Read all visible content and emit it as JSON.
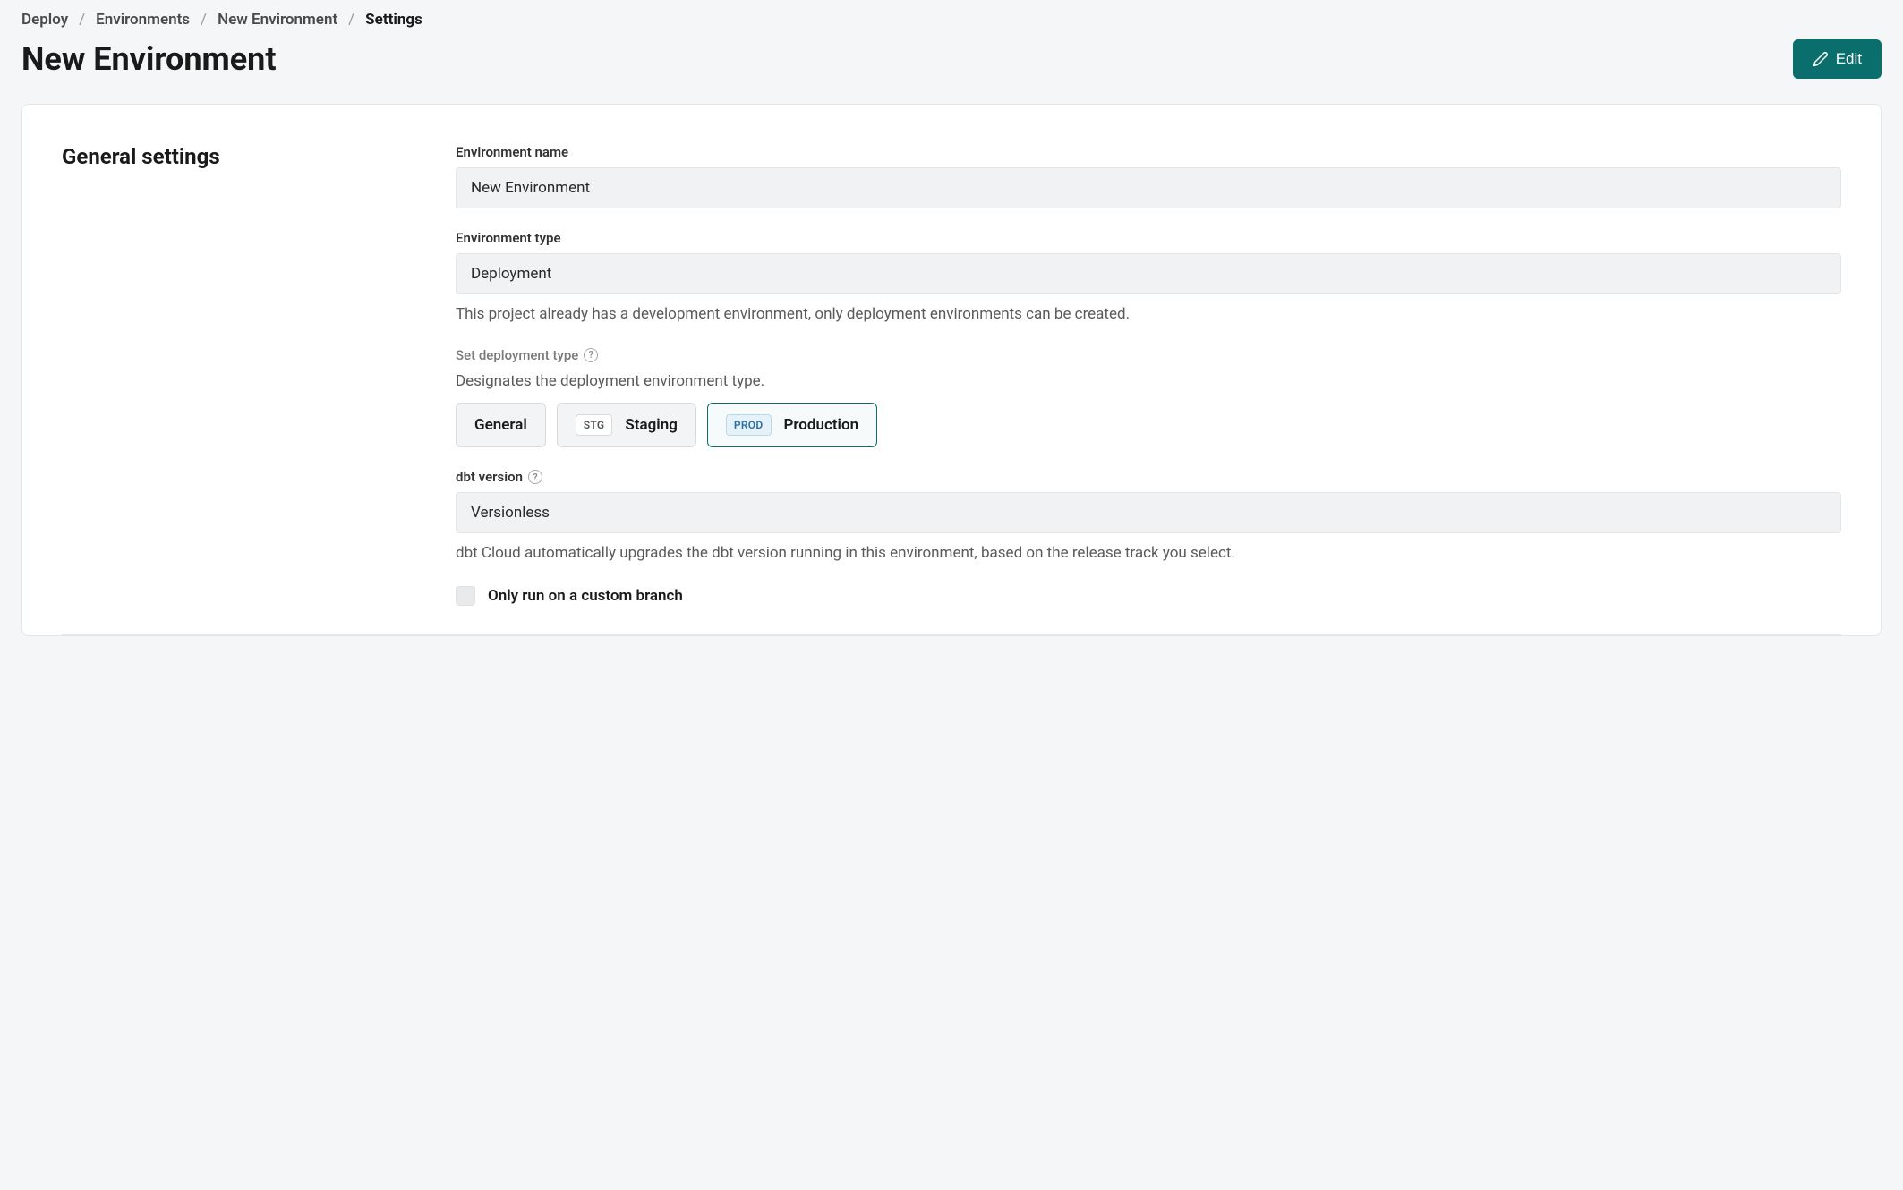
{
  "breadcrumb": {
    "items": [
      "Deploy",
      "Environments",
      "New Environment",
      "Settings"
    ]
  },
  "page": {
    "title": "New Environment",
    "edit_label": "Edit"
  },
  "sections": {
    "general": {
      "title": "General settings",
      "fields": {
        "env_name": {
          "label": "Environment name",
          "value": "New Environment"
        },
        "env_type": {
          "label": "Environment type",
          "value": "Deployment",
          "desc": "This project already has a development environment, only deployment environments can be created."
        },
        "deployment_type": {
          "label": "Set deployment type",
          "desc": "Designates the deployment environment type.",
          "options": [
            {
              "badge": null,
              "label": "General",
              "selected": false
            },
            {
              "badge": "STG",
              "label": "Staging",
              "selected": false
            },
            {
              "badge": "PROD",
              "label": "Production",
              "selected": true
            }
          ]
        },
        "dbt_version": {
          "label": "dbt version",
          "value": "Versionless",
          "desc": "dbt Cloud automatically upgrades the dbt version running in this environment, based on the release track you select."
        },
        "custom_branch": {
          "label": "Only run on a custom branch",
          "checked": false
        }
      }
    }
  }
}
